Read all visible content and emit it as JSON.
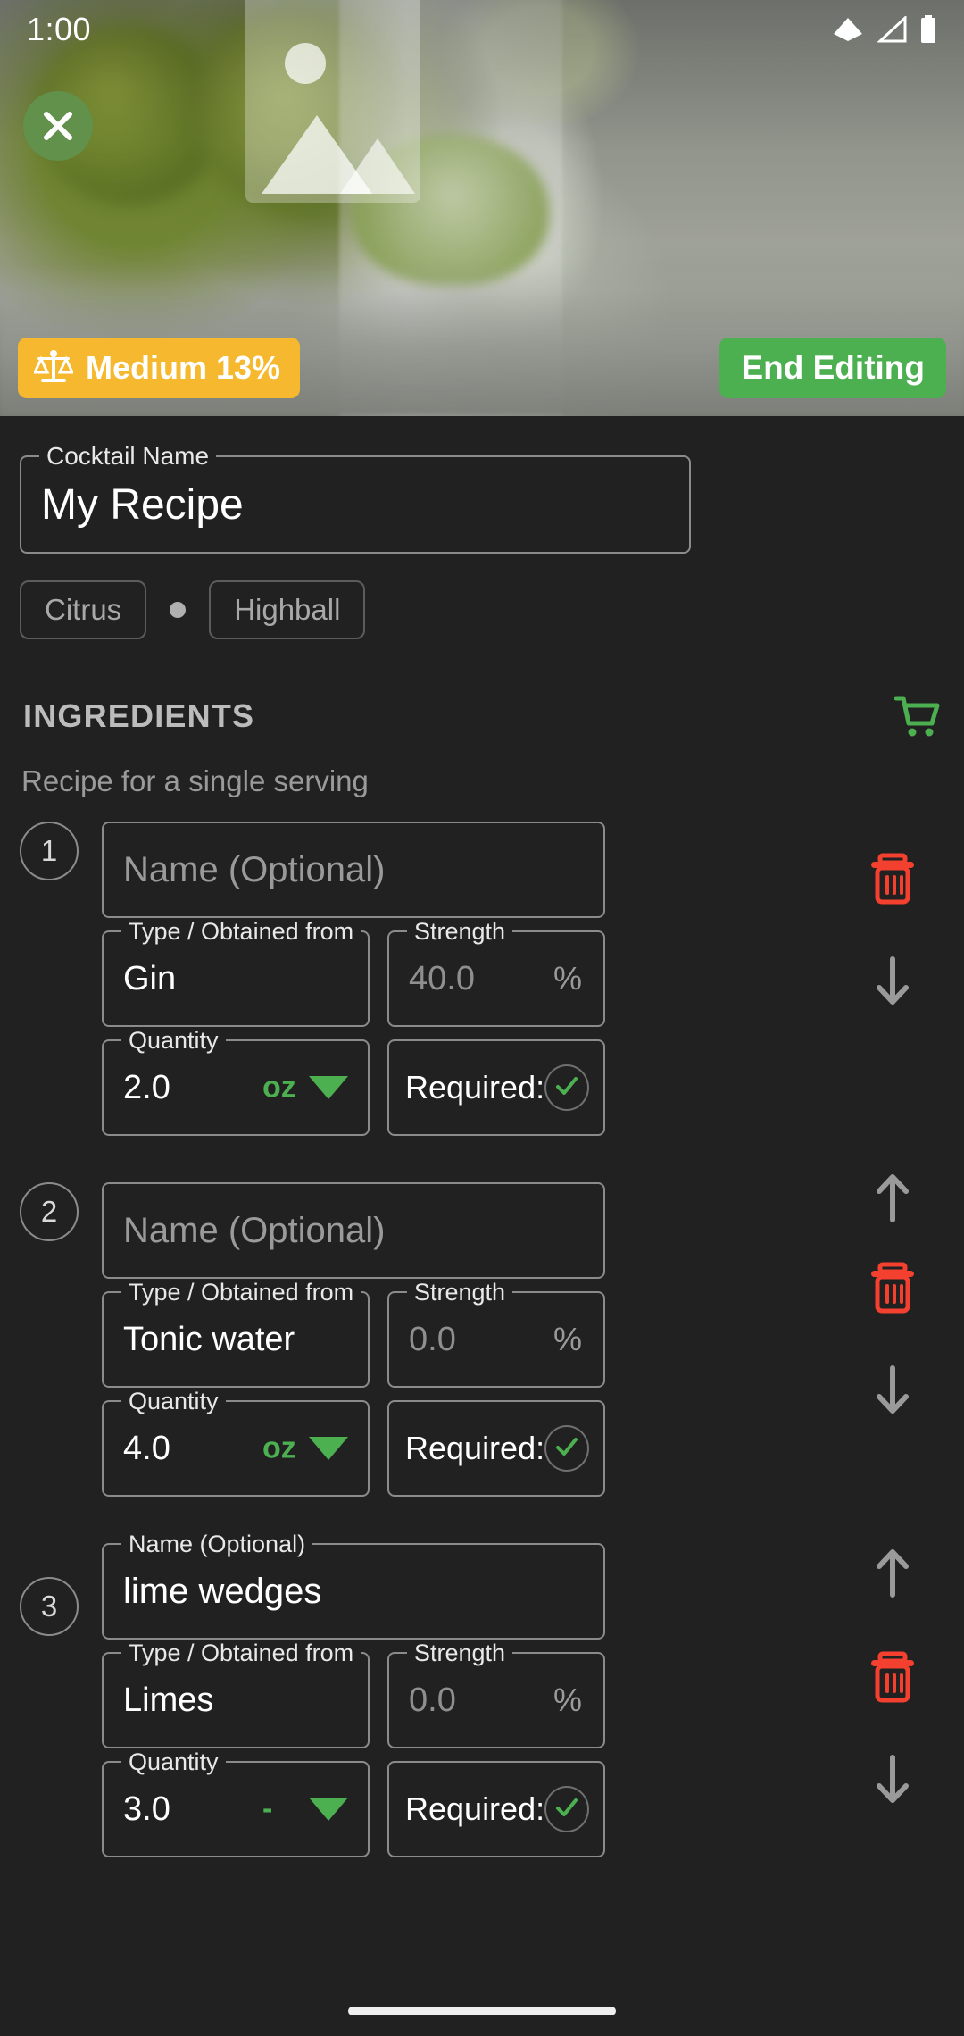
{
  "status_bar": {
    "time": "1:00",
    "icons": [
      "wifi-icon",
      "cellular-signal-icon",
      "battery-icon"
    ]
  },
  "hero": {
    "close_icon": "close-icon",
    "image_placeholder_icon": "image-placeholder-icon",
    "strength_badge": {
      "icon": "balance-scale-icon",
      "label": "Medium 13%"
    },
    "end_editing_button": "End Editing"
  },
  "recipe": {
    "name_field": {
      "label": "Cocktail Name",
      "value": "My Recipe"
    },
    "chips": [
      "Citrus",
      "Highball"
    ]
  },
  "ingredients_section": {
    "title": "INGREDIENTS",
    "cart_icon": "shopping-cart-icon",
    "subtitle": "Recipe for a single serving",
    "labels": {
      "name": "Name (Optional)",
      "type": "Type / Obtained from",
      "strength": "Strength",
      "quantity": "Quantity",
      "required": "Required:",
      "percent_suffix": "%"
    },
    "items": [
      {
        "index": "1",
        "name_value": "",
        "name_placeholder": "Name (Optional)",
        "type_value": "Gin",
        "strength_value": "",
        "strength_placeholder": "40.0",
        "quantity_value": "2.0",
        "unit": "oz",
        "required_checked": true,
        "actions": [
          "delete-icon",
          "move-down-icon"
        ]
      },
      {
        "index": "2",
        "name_value": "",
        "name_placeholder": "Name (Optional)",
        "type_value": "Tonic water",
        "strength_value": "",
        "strength_placeholder": "0.0",
        "quantity_value": "4.0",
        "unit": "oz",
        "required_checked": true,
        "actions": [
          "move-up-icon",
          "delete-icon",
          "move-down-icon"
        ]
      },
      {
        "index": "3",
        "name_value": "lime wedges",
        "name_placeholder": "Name (Optional)",
        "type_value": "Limes",
        "strength_value": "",
        "strength_placeholder": "0.0",
        "quantity_value": "3.0",
        "unit": "-",
        "required_checked": true,
        "actions": [
          "move-up-icon",
          "delete-icon"
        ]
      }
    ]
  },
  "colors": {
    "background": "#212121",
    "accent_green": "#4caf50",
    "badge_amber": "#f5b82e",
    "delete_red": "#f4402e",
    "close_green": "#61914a"
  }
}
